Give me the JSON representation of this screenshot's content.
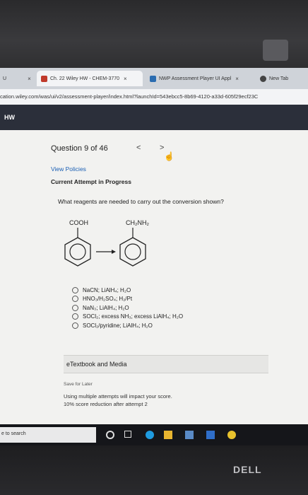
{
  "browser": {
    "tabs": [
      {
        "label": "U",
        "close": "×"
      },
      {
        "label": "Ch. 22 Wiley HW - CHEM-3770",
        "close": "×",
        "icon_color": "#c0392b"
      },
      {
        "label": "NWP Assessment Player UI Appl",
        "close": "×",
        "icon_color": "#2b6cb0"
      },
      {
        "label": "New Tab",
        "icon_color": "#444444"
      }
    ],
    "url": "cation.wiley.com/was/ui/v2/assessment-player/index.html?launchId=543ebcc5-8b69-4120-a33d-605f29ecf23C"
  },
  "app_header": {
    "title": "HW"
  },
  "question": {
    "title": "Question 9 of 46",
    "prev": "<",
    "next": ">",
    "view_policies": "View Policies",
    "attempt_status": "Current Attempt in Progress",
    "prompt": "What reagents are needed to carry out the conversion shown?",
    "reactant_label": "COOH",
    "product_label": "CH₂NH₂",
    "options": [
      "NaCN; LiAlH₄; H₂O",
      "HNO₃/H₂SO₄; H₂/Pt",
      "NaN₃; LiAlH₄; H₂O",
      "SOCl₂; excess NH₃; excess LiAlH₄; H₂O",
      "SOCl₂/pyridine; LiAlH₄; H₂O"
    ]
  },
  "etextbook": {
    "label": "eTextbook and Media"
  },
  "footer": {
    "save_for_later": "Save for Later",
    "attempts_note": "Using multiple attempts will impact your score.",
    "reduction_note": "10% score reduction after attempt 2"
  },
  "taskbar": {
    "search_text": "e to search"
  },
  "brand": {
    "logo": "DELL"
  },
  "colors": {
    "link": "#1a5fb4",
    "header_bg": "#2b2f3a",
    "taskbar_bg": "#15161a"
  }
}
